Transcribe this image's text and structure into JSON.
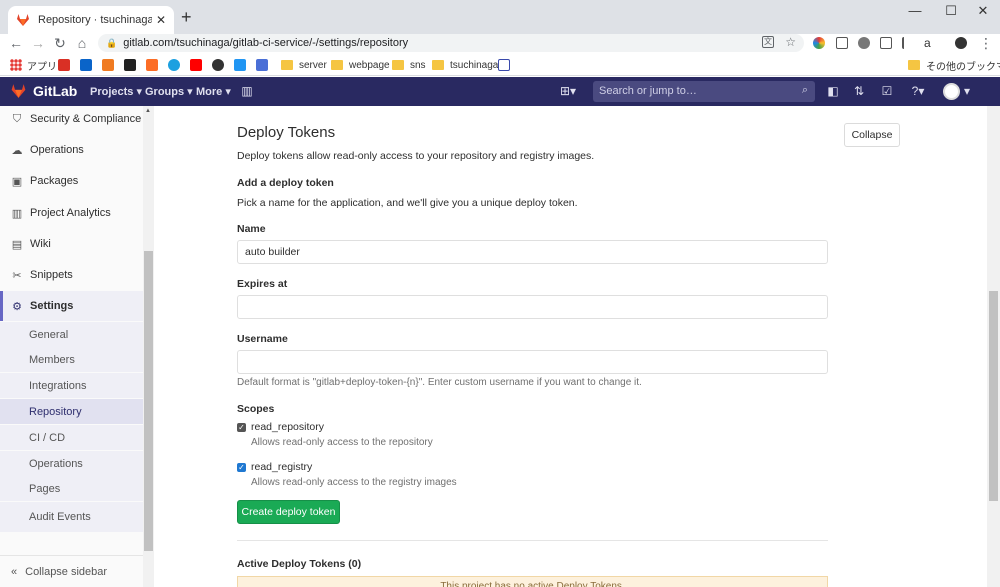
{
  "browser": {
    "tab_title": "Repository · tsuchinaga / gitlab-c",
    "tab_close": "✕",
    "new_tab": "+",
    "url": "gitlab.com/tsuchinaga/gitlab-ci-service/-/settings/repository",
    "window": {
      "minimize": "—",
      "maximize": "☐",
      "close": "✕"
    },
    "nav": {
      "back": "←",
      "forward": "→",
      "reload": "↻",
      "home": "⌂",
      "menu": "⋮"
    },
    "bookmarks": [
      {
        "label": "アプリ"
      },
      {
        "label": "server"
      },
      {
        "label": "webpage"
      },
      {
        "label": "sns"
      },
      {
        "label": "tsuchinaga"
      },
      {
        "label": "その他のブックマーク"
      }
    ]
  },
  "gitlab": {
    "brand": "GitLab",
    "nav": [
      {
        "label": "Projects ▾"
      },
      {
        "label": "Groups ▾"
      },
      {
        "label": "More ▾"
      }
    ],
    "search_placeholder": "Search or jump to…",
    "colors": {
      "header": "#292961",
      "primary_button": "#1aaa55",
      "active_nav": "#6666c4"
    }
  },
  "sidebar": {
    "items": [
      {
        "label": "Security & Compliance",
        "icon": "shield-icon",
        "glyph": "⛉"
      },
      {
        "label": "Operations",
        "icon": "cloud-icon",
        "glyph": "☁"
      },
      {
        "label": "Packages",
        "icon": "package-icon",
        "glyph": "▣"
      },
      {
        "label": "Project Analytics",
        "icon": "chart-icon",
        "glyph": "▥"
      },
      {
        "label": "Wiki",
        "icon": "book-icon",
        "glyph": "▤"
      },
      {
        "label": "Snippets",
        "icon": "scissors-icon",
        "glyph": "✂"
      },
      {
        "label": "Settings",
        "icon": "gear-icon",
        "glyph": "⚙"
      }
    ],
    "subitems": [
      {
        "label": "General"
      },
      {
        "label": "Members"
      },
      {
        "label": "Integrations"
      },
      {
        "label": "Repository"
      },
      {
        "label": "CI / CD"
      },
      {
        "label": "Operations"
      },
      {
        "label": "Pages"
      },
      {
        "label": "Audit Events"
      }
    ],
    "collapse_label": "Collapse sidebar"
  },
  "main": {
    "section_title": "Deploy Tokens",
    "section_desc": "Deploy tokens allow read-only access to your repository and registry images.",
    "collapse_button": "Collapse",
    "add_title": "Add a deploy token",
    "add_desc": "Pick a name for the application, and we'll give you a unique deploy token.",
    "name_label": "Name",
    "name_value": "auto builder",
    "expires_label": "Expires at",
    "expires_value": "",
    "username_label": "Username",
    "username_value": "",
    "username_hint": "Default format is \"gitlab+deploy-token-{n}\". Enter custom username if you want to change it.",
    "scopes_label": "Scopes",
    "scopes": [
      {
        "name": "read_repository",
        "desc": "Allows read-only access to the repository",
        "checked": true
      },
      {
        "name": "read_registry",
        "desc": "Allows read-only access to the registry images",
        "checked": true
      }
    ],
    "create_button": "Create deploy token",
    "active_title": "Active Deploy Tokens (0)",
    "empty_message": "This project has no active Deploy Tokens."
  }
}
